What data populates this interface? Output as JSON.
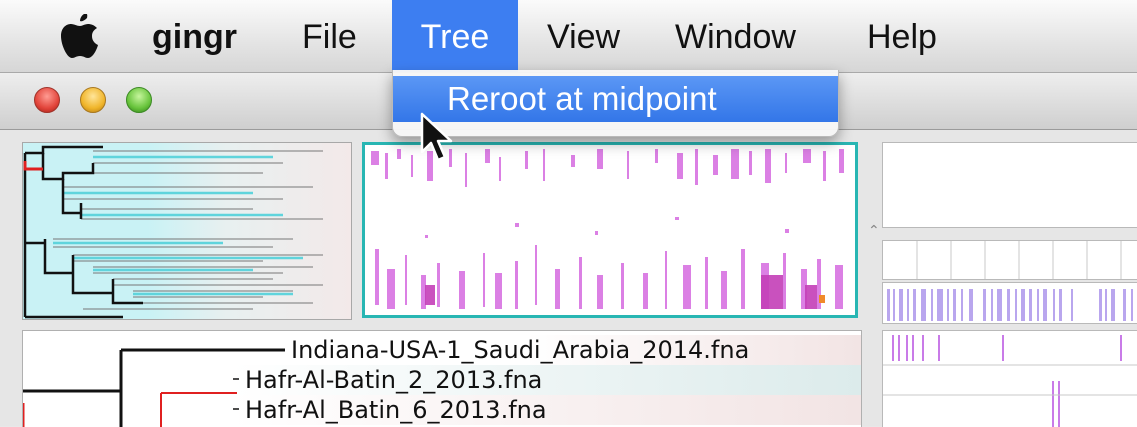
{
  "menubar": {
    "apple_icon": "apple-logo",
    "app_name": "gingr",
    "menus": [
      "File",
      "Tree",
      "View",
      "Window",
      "Help"
    ],
    "active_menu": "Tree"
  },
  "dropdown": {
    "items": [
      {
        "label": "Reroot at midpoint",
        "highlighted": true
      }
    ]
  },
  "window": {
    "traffic_lights": {
      "close": "#e2453b",
      "minimize": "#f0b52a",
      "zoom": "#68c43c"
    }
  },
  "tree": {
    "leaves": [
      "Indiana-USA-1_Saudi_Arabia_2014.fna",
      "Hafr-Al-Batin_2_2013.fna",
      "Hafr-Al_Batin_6_2013.fna"
    ]
  },
  "colors": {
    "selection_blue": "#3d7ef1",
    "alignment_frame": "#28b6b3",
    "tree_shade": "#c9f2f5",
    "snp_magenta": "#d56be0",
    "branch_highlight": "#e02020"
  }
}
